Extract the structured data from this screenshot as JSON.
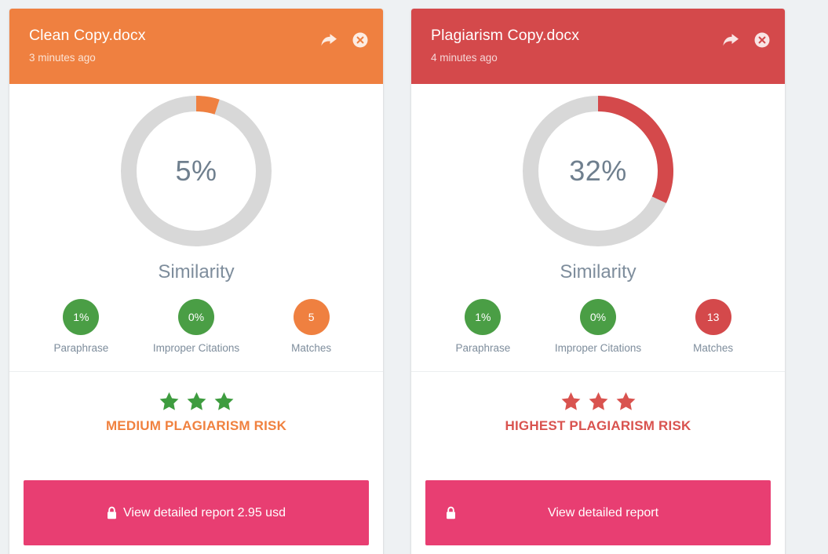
{
  "theme": {
    "background": "#eef1f3",
    "card_background": "#ffffff",
    "orange": "#ef8040",
    "red": "#d4494b",
    "green": "#4a9e45",
    "pink": "#e83e72",
    "track_gray": "#d8d8d8",
    "muted_text": "#7e8d9c"
  },
  "cards": [
    {
      "id": "clean-copy",
      "header": {
        "title": "Clean Copy.docx",
        "timestamp": "3 minutes ago",
        "color": "#ef8040",
        "share_icon": "share-arrow-icon",
        "close_icon": "close-circle-icon"
      },
      "gauge": {
        "value_label": "5%",
        "percent": 5,
        "label": "Similarity",
        "arc_color": "#ef8040",
        "track_color": "#d8d8d8"
      },
      "metrics": [
        {
          "value": "1%",
          "label": "Paraphrase",
          "color": "#4a9e45"
        },
        {
          "value": "0%",
          "label": "Improper Citations",
          "color": "#4a9e45"
        },
        {
          "value": "5",
          "label": "Matches",
          "color": "#ef8040"
        }
      ],
      "risk": {
        "stars": 3,
        "star_color": "#3e9c3f",
        "text": "MEDIUM PLAGIARISM RISK",
        "text_color": "#f0813f"
      },
      "cta": {
        "label": "View detailed report 2.95 usd",
        "icon": "lock-icon",
        "layout": "centered",
        "color": "#e83e72"
      }
    },
    {
      "id": "plagiarism-copy",
      "header": {
        "title": "Plagiarism Copy.docx",
        "timestamp": "4 minutes ago",
        "color": "#d4494b",
        "share_icon": "share-arrow-icon",
        "close_icon": "close-circle-icon"
      },
      "gauge": {
        "value_label": "32%",
        "percent": 32,
        "label": "Similarity",
        "arc_color": "#d4494b",
        "track_color": "#d8d8d8"
      },
      "metrics": [
        {
          "value": "1%",
          "label": "Paraphrase",
          "color": "#4a9e45"
        },
        {
          "value": "0%",
          "label": "Improper Citations",
          "color": "#4a9e45"
        },
        {
          "value": "13",
          "label": "Matches",
          "color": "#d4494b"
        }
      ],
      "risk": {
        "stars": 3,
        "star_color": "#d9534f",
        "text": "HIGHEST PLAGIARISM RISK",
        "text_color": "#d9534f"
      },
      "cta": {
        "label": "View detailed report",
        "icon": "lock-icon",
        "layout": "split",
        "color": "#e83e72"
      }
    }
  ],
  "chart_data": [
    {
      "type": "pie",
      "title": "Similarity",
      "subtitle": "Clean Copy.docx",
      "labels": [
        "Similarity",
        "Remaining"
      ],
      "values": [
        5,
        95
      ],
      "center_label": "5%",
      "colors": [
        "#ef8040",
        "#d8d8d8"
      ],
      "donut": true,
      "start_angle": 90,
      "legend": "none"
    },
    {
      "type": "pie",
      "title": "Similarity",
      "subtitle": "Plagiarism Copy.docx",
      "labels": [
        "Similarity",
        "Remaining"
      ],
      "values": [
        32,
        68
      ],
      "center_label": "32%",
      "colors": [
        "#d4494b",
        "#d8d8d8"
      ],
      "donut": true,
      "start_angle": 90,
      "legend": "none"
    }
  ]
}
